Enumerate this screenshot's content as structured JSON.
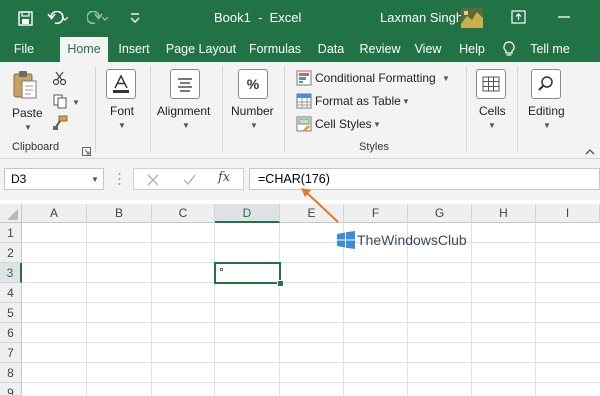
{
  "title_bar": {
    "document_title": "Book1  -  Excel",
    "user_name": "Laxman Singh",
    "qat": [
      "save-icon",
      "undo-icon",
      "redo-icon",
      "customize-icon"
    ]
  },
  "tabs": [
    {
      "label": "File",
      "active": false
    },
    {
      "label": "Home",
      "active": true
    },
    {
      "label": "Insert",
      "active": false
    },
    {
      "label": "Page Layout",
      "active": false
    },
    {
      "label": "Formulas",
      "active": false
    },
    {
      "label": "Data",
      "active": false
    },
    {
      "label": "Review",
      "active": false
    },
    {
      "label": "View",
      "active": false
    },
    {
      "label": "Help",
      "active": false
    },
    {
      "label": "Tell me",
      "active": false
    }
  ],
  "ribbon": {
    "paste_label": "Paste",
    "clipboard_label": "Clipboard",
    "font_label": "Font",
    "alignment_label": "Alignment",
    "number_label": "Number",
    "number_glyph": "%",
    "conditional_formatting": "Conditional Formatting",
    "format_as_table": "Format as Table",
    "cell_styles": "Cell Styles",
    "styles_label": "Styles",
    "cells_label": "Cells",
    "editing_label": "Editing"
  },
  "formula_bar": {
    "name_box": "D3",
    "fx": "fx",
    "formula": "=CHAR(176)"
  },
  "sheet": {
    "columns": [
      "A",
      "B",
      "C",
      "D",
      "E",
      "F",
      "G",
      "H",
      "I"
    ],
    "rows": [
      "1",
      "2",
      "3",
      "4",
      "5",
      "6",
      "7",
      "8",
      "9"
    ],
    "selected_cell": "D3",
    "selected_cell_value": "°"
  },
  "watermark": "TheWindowsClub",
  "colors": {
    "excel_green": "#217346",
    "ribbon_bg": "#f3f3f3",
    "arrow": "#e07b28"
  }
}
